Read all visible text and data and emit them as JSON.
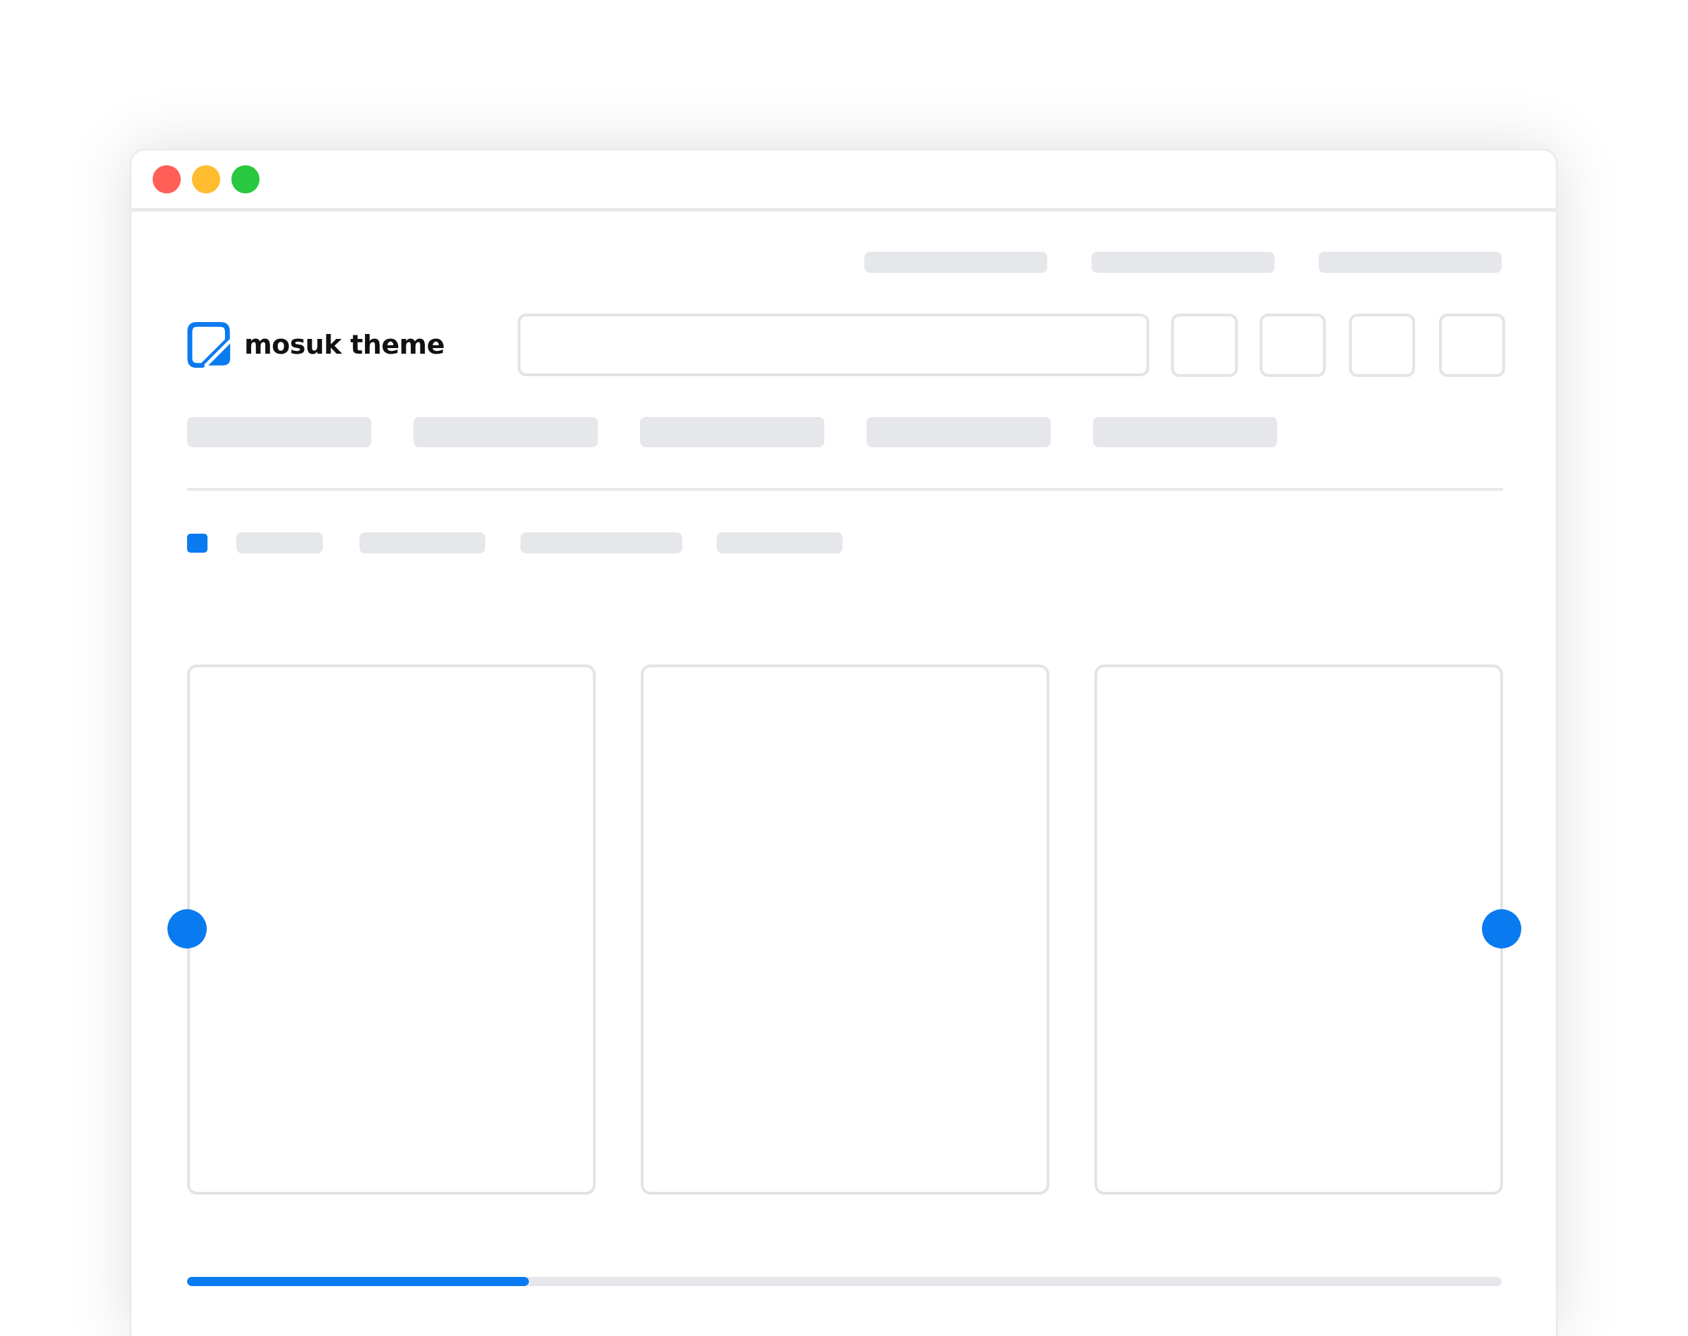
{
  "logo": {
    "text": "mosuk theme"
  },
  "carousel": {
    "progress": {
      "level": 0.26
    }
  }
}
